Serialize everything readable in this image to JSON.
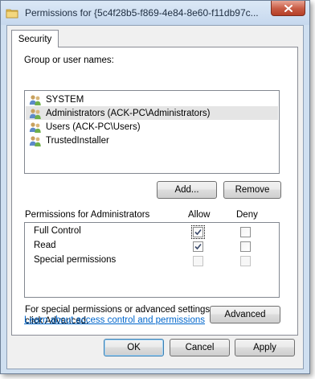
{
  "window": {
    "title": "Permissions for {5c4f28b5-f869-4e84-8e60-f11db97c..."
  },
  "tabs": [
    {
      "label": "Security"
    }
  ],
  "groups": {
    "label": "Group or user names:",
    "items": [
      {
        "name": "SYSTEM",
        "icon": "users-group-icon"
      },
      {
        "name": "Administrators (ACK-PC\\Administrators)",
        "icon": "users-group-icon",
        "selected": true
      },
      {
        "name": "Users (ACK-PC\\Users)",
        "icon": "users-group-icon"
      },
      {
        "name": "TrustedInstaller",
        "icon": "users-group-icon"
      }
    ],
    "add_label": "Add...",
    "remove_label": "Remove"
  },
  "permissions": {
    "header": "Permissions for Administrators",
    "allow_label": "Allow",
    "deny_label": "Deny",
    "rows": [
      {
        "name": "Full Control",
        "allow": "checked",
        "deny": "unchecked"
      },
      {
        "name": "Read",
        "allow": "checked",
        "deny": "unchecked"
      },
      {
        "name": "Special permissions",
        "allow": "disabled",
        "deny": "disabled"
      }
    ]
  },
  "advanced": {
    "text_line1": "For special permissions or advanced settings,",
    "text_line2": "click Advanced.",
    "button_label": "Advanced"
  },
  "link": {
    "label": "Learn about access control and permissions"
  },
  "footer": {
    "ok_label": "OK",
    "cancel_label": "Cancel",
    "apply_label": "Apply"
  },
  "colors": {
    "link": "#0066cc",
    "frame": "#cfdff0",
    "selected_row": "#e5e5e5"
  }
}
